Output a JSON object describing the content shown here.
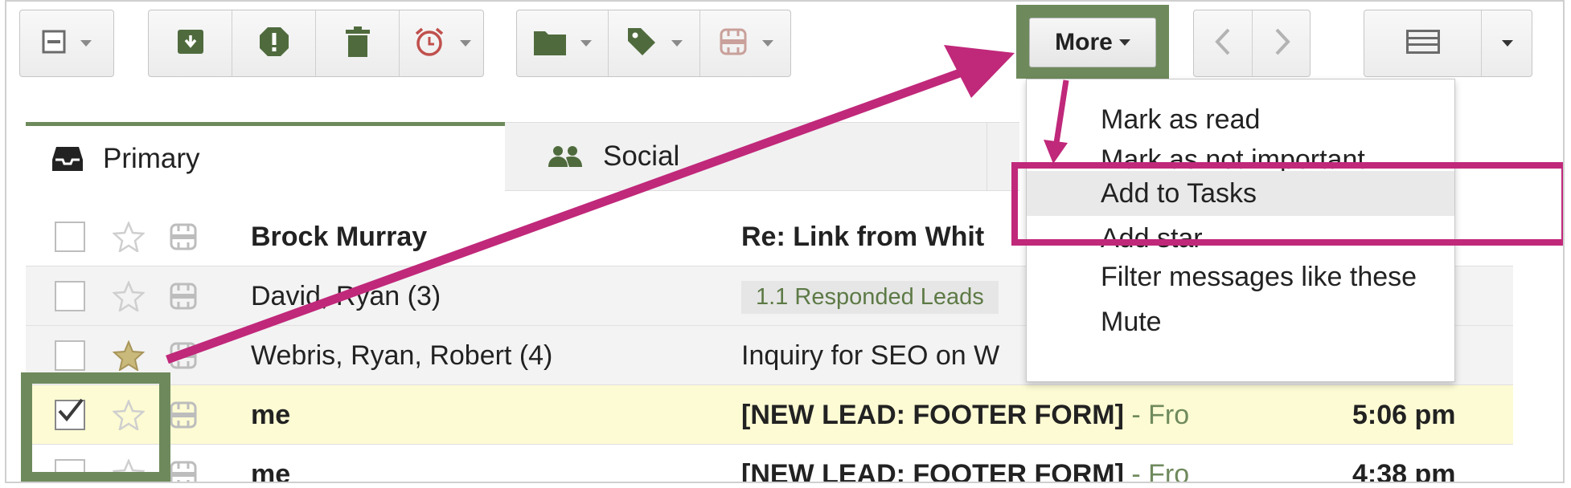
{
  "toolbar": {
    "more_label": "More",
    "icons": [
      "select-all-icon",
      "archive-icon",
      "report-spam-icon",
      "delete-icon",
      "snooze-icon",
      "move-to-folder-icon",
      "label-tag-icon",
      "tasks-icon",
      "prev-icon",
      "next-icon",
      "density-icon",
      "settings-caret-icon"
    ]
  },
  "tabs": [
    {
      "label": "Primary"
    },
    {
      "label": "Social"
    }
  ],
  "emails": [
    {
      "sender": "Brock Murray",
      "subject": "Re: Link from Whit",
      "snippet": "",
      "badge": "",
      "time": "",
      "unread": true,
      "starred": false,
      "selected": false
    },
    {
      "sender": "David, Ryan (3)",
      "subject": "",
      "snippet": "",
      "badge": "1.1 Responded Leads",
      "time": "",
      "unread": false,
      "starred": false,
      "selected": false
    },
    {
      "sender": "Webris, Ryan, Robert (4)",
      "subject": "Inquiry for SEO on W",
      "snippet": "",
      "badge": "",
      "time": "",
      "unread": false,
      "starred": true,
      "selected": false
    },
    {
      "sender": "me",
      "subject": "[NEW LEAD: FOOTER FORM]",
      "snippet": " - Fro",
      "badge": "",
      "time": "5:06 pm",
      "unread": true,
      "starred": false,
      "selected": true
    },
    {
      "sender": "me",
      "subject": "[NEW LEAD: FOOTER FORM]",
      "snippet": " - Fro",
      "badge": "",
      "time": "4:38 pm",
      "unread": true,
      "starred": false,
      "selected": false
    }
  ],
  "more_menu": {
    "items": [
      "Mark as read",
      "Mark as not important",
      "Add to Tasks",
      "Add star",
      "Filter messages like these",
      "Mute"
    ],
    "highlighted": "Add to Tasks"
  },
  "colors": {
    "accent_green": "#6e8a5c",
    "annotation_magenta": "#c0287a",
    "selected_row": "#fdfbd3"
  }
}
